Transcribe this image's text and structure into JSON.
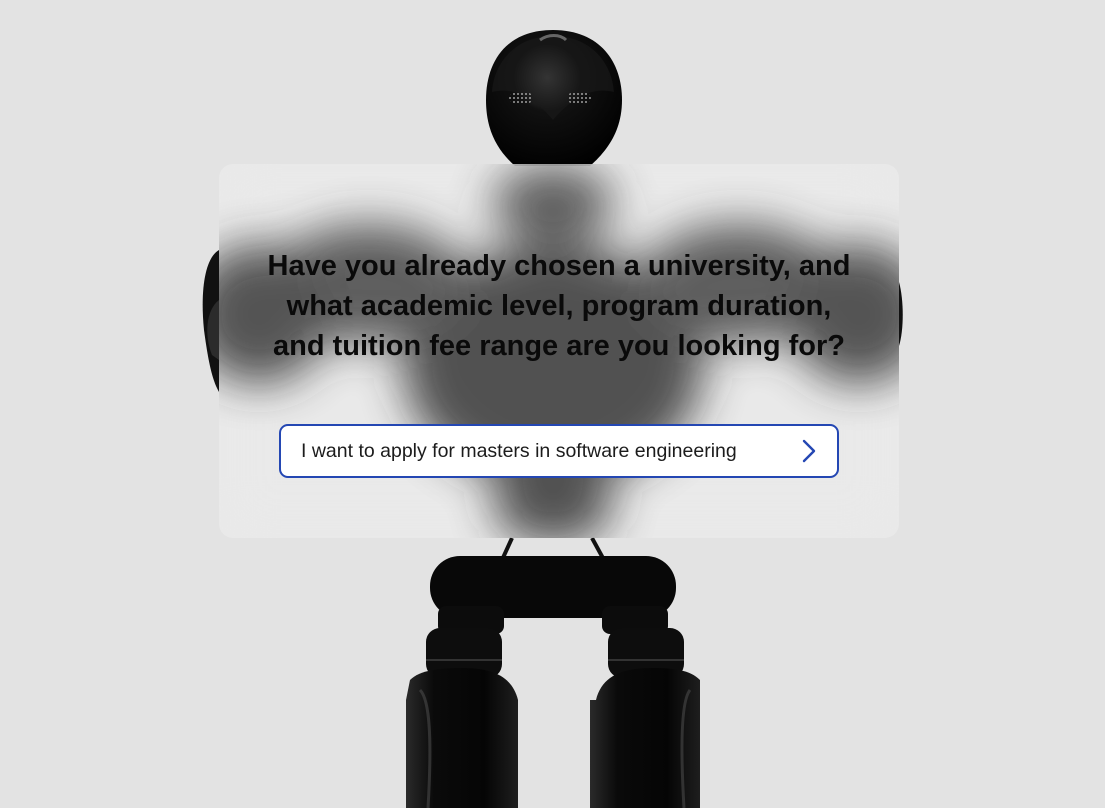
{
  "prompt": {
    "question": "Have you already chosen a university, and what academic level, program duration, and tuition fee range are you looking for?"
  },
  "answer": {
    "value": "I want to apply for masters in software engineering"
  },
  "icons": {
    "submit": "chevron-right-icon"
  },
  "colors": {
    "background": "#e3e3e3",
    "accent_border": "#2447b3",
    "chevron": "#2447b3",
    "text": "#0a0a0a"
  }
}
